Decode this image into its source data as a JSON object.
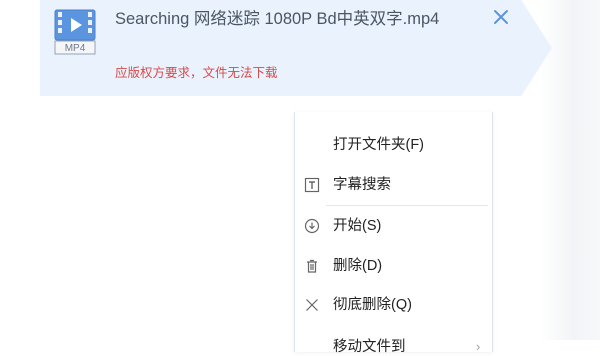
{
  "download": {
    "file_type": "MP4",
    "title": "Searching 网络迷踪 1080P Bd中英双字.mp4",
    "warning": "应版权方要求，文件无法下载"
  },
  "context_menu": {
    "items": [
      {
        "label": "打开文件夹(F)",
        "icon": ""
      },
      {
        "label": "字幕搜索",
        "icon": "subtitle-icon"
      },
      {
        "label": "开始(S)",
        "icon": "download-start-icon"
      },
      {
        "label": "删除(D)",
        "icon": "trash-icon"
      },
      {
        "label": "彻底删除(Q)",
        "icon": "close-icon"
      },
      {
        "label": "移动文件到",
        "icon": ""
      }
    ]
  },
  "colors": {
    "card_background": "#eaf3fd",
    "warning_text": "#d94a4a",
    "title_text": "#4b5663",
    "accent": "#5b95e0"
  }
}
